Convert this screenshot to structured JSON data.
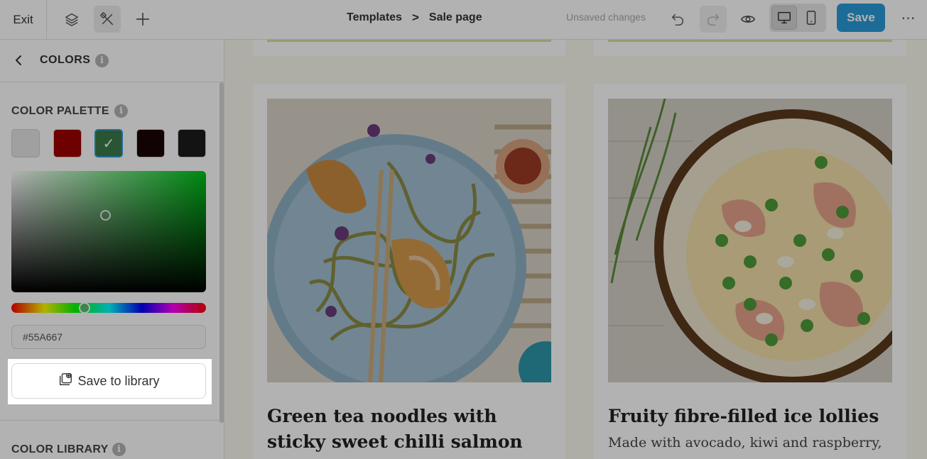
{
  "topbar": {
    "exit_label": "Exit",
    "icons": [
      "layers-icon",
      "tools-icon",
      "plus-icon",
      "undo-icon",
      "redo-icon",
      "eye-icon",
      "desktop-icon",
      "mobile-icon",
      "more-icon"
    ],
    "breadcrumb": {
      "parent": "Templates",
      "separator": ">",
      "current": "Sale page"
    },
    "status": "Unsaved changes",
    "save_label": "Save",
    "more_label": "⋯"
  },
  "panel": {
    "title": "COLORS",
    "info_glyph": "i",
    "palette": {
      "title": "COLOR PALETTE",
      "swatches": [
        "#e6e6e6",
        "#a00000",
        "#3c7a4a",
        "#1c0405",
        "#1c1c1c"
      ],
      "selected_index": 2,
      "check_glyph": "✓"
    },
    "picker": {
      "hue_color": "#00c41a"
    },
    "hex_value": "#55A667",
    "save_library_label": "Save to library",
    "library": {
      "title": "COLOR LIBRARY"
    }
  },
  "canvas": {
    "accent_color": "#d7e0a2",
    "cards": [
      {
        "title": "Green tea noodles with sticky sweet chilli salmon",
        "subtitle": ""
      },
      {
        "title": "Fruity fibre-filled ice lollies",
        "subtitle": "Made with avocado, kiwi and raspberry,"
      }
    ]
  },
  "colors": {
    "brand": "#2a9bd8"
  }
}
